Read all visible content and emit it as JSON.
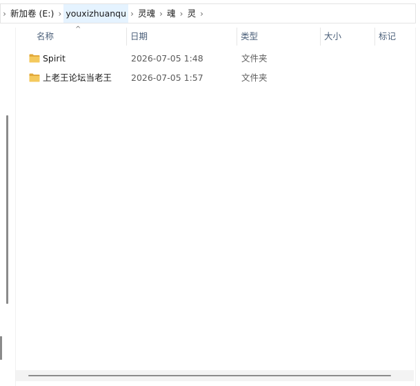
{
  "breadcrumb": {
    "items": [
      {
        "label": "新加卷 (E:)"
      },
      {
        "label": "youxizhuanqu"
      },
      {
        "label": "灵魂"
      },
      {
        "label": "魂"
      },
      {
        "label": "灵"
      }
    ],
    "separator": "›"
  },
  "columns": {
    "name": "名称",
    "date": "日期",
    "type": "类型",
    "size": "大小",
    "tags": "标记",
    "sort_indicator": "^"
  },
  "files": [
    {
      "name": "Spirit",
      "date": "2026-07-05 1:48",
      "type": "文件夹",
      "icon": "folder-icon"
    },
    {
      "name": "上老王论坛当老王",
      "date": "2026-07-05 1:57",
      "type": "文件夹",
      "icon": "folder-icon"
    }
  ],
  "colors": {
    "folder": "#f4c95d",
    "folder_dark": "#e2a93a",
    "header_text": "#4c607a",
    "active_crumb_bg": "#e5f3ff"
  }
}
